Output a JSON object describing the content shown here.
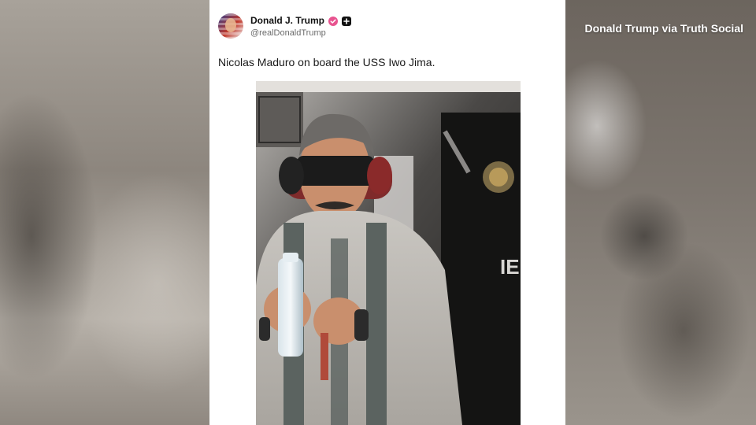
{
  "overlay": {
    "source_credit": "Donald Trump via Truth Social"
  },
  "post": {
    "display_name": "Donald J. Trump",
    "handle": "@realDonaldTrump",
    "text": "Nicolas Maduro on board the USS Iwo Jima.",
    "verified_icon": "verified-badge-icon",
    "secondary_icon": "plus-badge-icon",
    "colors": {
      "verified_badge": "#e8538f",
      "secondary_badge": "#111111"
    }
  }
}
